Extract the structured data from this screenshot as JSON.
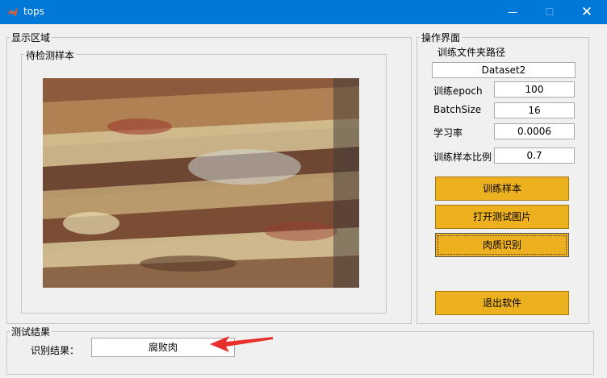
{
  "window": {
    "title": "tops",
    "minimize_glyph": "—",
    "maximize_glyph": "☐",
    "close_glyph": "✕",
    "accent_color": "#0078d7"
  },
  "display_panel": {
    "title": "显示区域",
    "sub_panel_title": "待检测样本"
  },
  "control_panel": {
    "title": "操作界面",
    "folder_label": "训练文件夹路径",
    "folder_value": "Dataset2",
    "params": [
      {
        "label": "训练epoch",
        "value": "100"
      },
      {
        "label": "BatchSize",
        "value": "16"
      },
      {
        "label": "学习率",
        "value": "0.0006"
      },
      {
        "label": "训练样本比例",
        "value": "0.7"
      }
    ],
    "buttons": {
      "train": "训练样本",
      "open_image": "打开测试图片",
      "identify": "肉质识别",
      "exit": "退出软件"
    },
    "button_color": "#edb120"
  },
  "result_panel": {
    "title": "测试结果",
    "label": "识别结果：",
    "value": "腐败肉",
    "annotation_color": "#e8312c"
  }
}
